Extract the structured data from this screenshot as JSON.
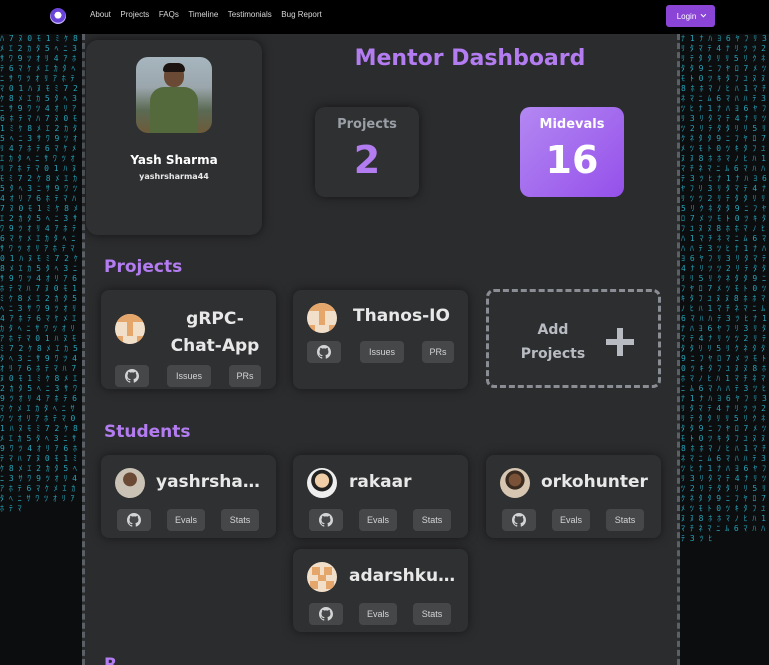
{
  "nav": {
    "links": [
      "About",
      "Projects",
      "FAQs",
      "Timeline",
      "Testimonials",
      "Bug Report"
    ],
    "login_label": "Login"
  },
  "profile": {
    "name": "Yash Sharma",
    "username": "yashrsharma44"
  },
  "dashboard": {
    "title": "Mentor Dashboard",
    "projects_label": "Projects",
    "projects_count": "2",
    "midevals_label": "Midevals",
    "midevals_count": "16"
  },
  "sections": {
    "projects": "Projects",
    "students": "Students",
    "next_partial": "R"
  },
  "projects": [
    {
      "title": "gRPC-Chat-App",
      "issues_label": "Issues",
      "prs_label": "PRs"
    },
    {
      "title": "Thanos-IO",
      "issues_label": "Issues",
      "prs_label": "PRs"
    }
  ],
  "add_project": {
    "label": "Add Projects"
  },
  "students": [
    {
      "name": "yashrsharm...",
      "evals_label": "Evals",
      "stats_label": "Stats"
    },
    {
      "name": "rakaar",
      "evals_label": "Evals",
      "stats_label": "Stats"
    },
    {
      "name": "orkohunter",
      "evals_label": "Evals",
      "stats_label": "Stats"
    },
    {
      "name": "adarshkuma...",
      "evals_label": "Evals",
      "stats_label": "Stats"
    }
  ],
  "colors": {
    "accent": "#b37cf0",
    "accent_strong": "#9550ea",
    "panel": "#2b2c2e",
    "card": "#2f3032",
    "matrix": "#2bb3c9"
  },
  "icons": [
    "github-icon",
    "plus-icon",
    "chevron-down-icon"
  ]
}
